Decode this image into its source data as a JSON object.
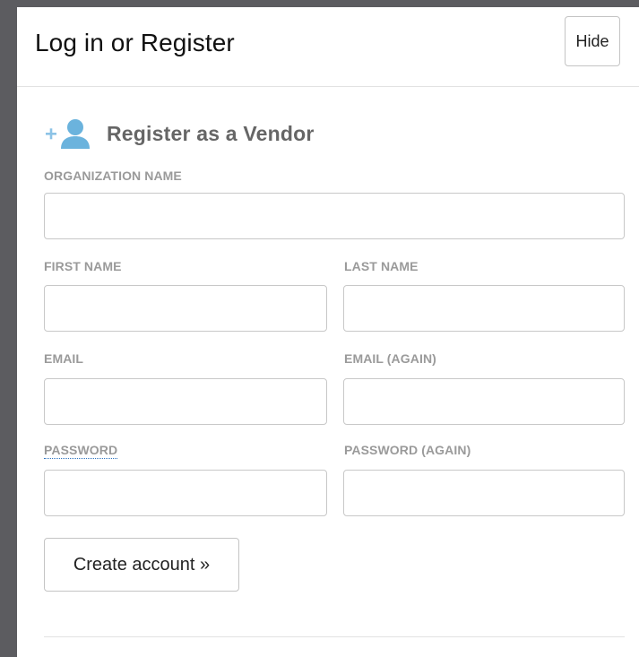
{
  "header": {
    "title": "Log in or Register",
    "hide_label": "Hide"
  },
  "register": {
    "icon": "add-user-icon",
    "title": "Register as a Vendor",
    "fields": {
      "organization_name": {
        "label": "ORGANIZATION NAME",
        "value": ""
      },
      "first_name": {
        "label": "FIRST NAME",
        "value": ""
      },
      "last_name": {
        "label": "LAST NAME",
        "value": ""
      },
      "email": {
        "label": "EMAIL",
        "value": ""
      },
      "email_again": {
        "label": "EMAIL (AGAIN)",
        "value": ""
      },
      "password": {
        "label": "PASSWORD",
        "value": ""
      },
      "password_again": {
        "label": "PASSWORD (AGAIN)",
        "value": ""
      }
    },
    "submit_label": "Create account »"
  },
  "colors": {
    "background": "#5c5c60",
    "panel": "#ffffff",
    "icon_accent": "#6bb3dd",
    "label": "#9a9a9a",
    "section_title": "#666666",
    "link_underline": "#2f74c0"
  }
}
